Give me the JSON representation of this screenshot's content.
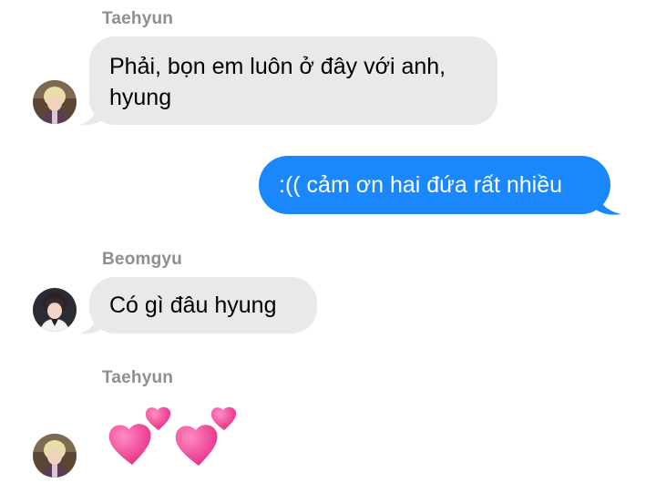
{
  "conversation": {
    "messages": [
      {
        "direction": "incoming",
        "sender": "Taehyun",
        "text_line1": "Phải, bọn em luôn ở đây với anh,",
        "text_line2": "hyung"
      },
      {
        "direction": "outgoing",
        "text": ":(( cảm ơn hai đứa rất nhiều"
      },
      {
        "direction": "incoming",
        "sender": "Beomgyu",
        "text": "Có gì đâu hyung"
      },
      {
        "direction": "incoming",
        "sender": "Taehyun",
        "emoji": "💕💕",
        "emoji_name": "two-hearts"
      }
    ]
  },
  "colors": {
    "incoming_bubble": "#e9e9eb",
    "outgoing_bubble": "#1a88fc",
    "sender_name": "#8e8e93",
    "heart": "#f0509a"
  },
  "icons": {
    "avatar_taehyun": "avatar-photo",
    "avatar_beomgyu": "avatar-photo",
    "hearts": "two-hearts-emoji"
  }
}
